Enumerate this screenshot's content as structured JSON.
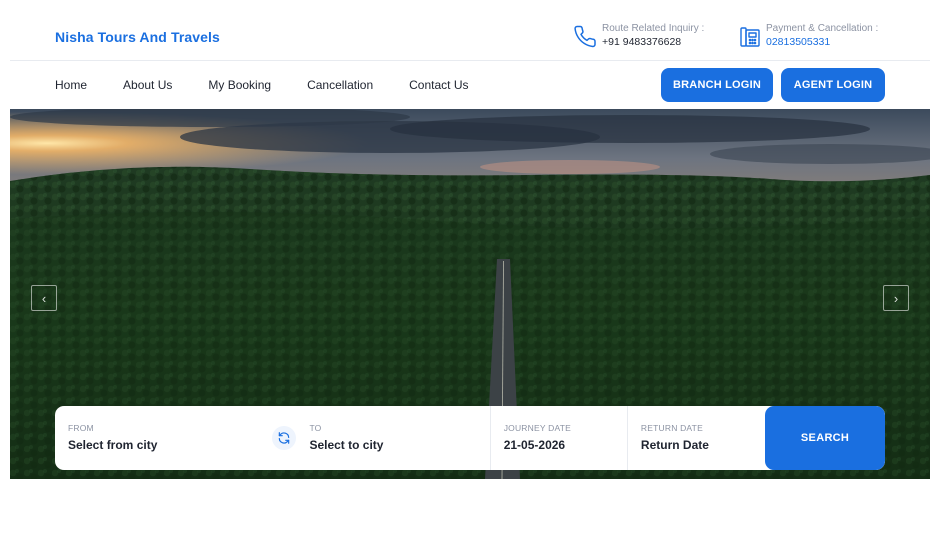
{
  "brand": {
    "name": "Nisha Tours And Travels"
  },
  "contacts": {
    "route": {
      "label": "Route Related Inquiry :",
      "value": "+91 9483376628",
      "icon": "phone-icon"
    },
    "payment": {
      "label": "Payment & Cancellation :",
      "value": "02813505331",
      "icon": "fax-icon"
    }
  },
  "nav": {
    "links": [
      "Home",
      "About Us",
      "My Booking",
      "Cancellation",
      "Contact Us"
    ],
    "branch_login": "BRANCH LOGIN",
    "agent_login": "AGENT LOGIN"
  },
  "slider": {
    "prev": "‹",
    "next": "›"
  },
  "search": {
    "from": {
      "label": "FROM",
      "value": "Select from city"
    },
    "to": {
      "label": "TO",
      "value": "Select to city"
    },
    "journey": {
      "label": "JOURNEY DATE",
      "value": "21-05-2026"
    },
    "return": {
      "label": "RETURN DATE",
      "value": "Return Date"
    },
    "button": "SEARCH"
  },
  "colors": {
    "accent": "#1a6fe0",
    "text": "#1f2430",
    "muted": "#8c93a3"
  }
}
